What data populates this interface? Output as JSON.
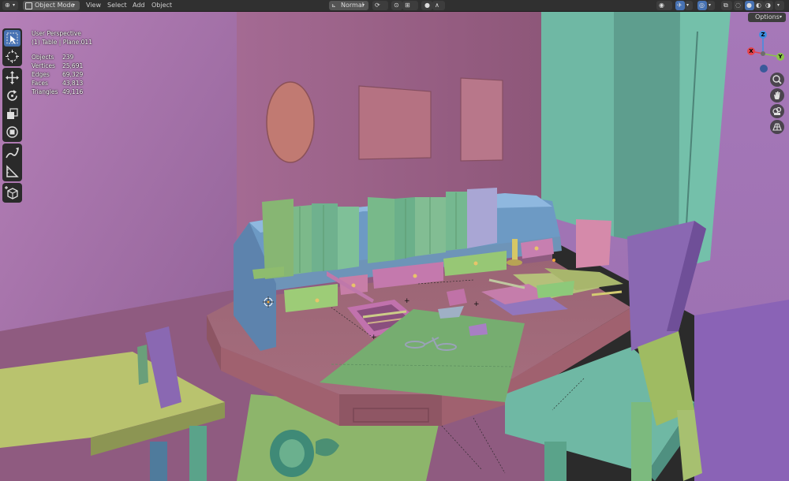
{
  "header": {
    "editor_type_icon": "3d-viewport-icon",
    "mode": "Object Mode",
    "menus": [
      "View",
      "Select",
      "Add",
      "Object"
    ],
    "transform_orientation": "Normal",
    "options_label": "Options"
  },
  "overlay": {
    "view_name": "User Perspective",
    "object_name": "(1) Table | Plane.011",
    "stats": [
      {
        "label": "Objects",
        "value": "239"
      },
      {
        "label": "Vertices",
        "value": "25,691"
      },
      {
        "label": "Edges",
        "value": "69,329"
      },
      {
        "label": "Faces",
        "value": "43,813"
      },
      {
        "label": "Triangles",
        "value": "49,116"
      }
    ]
  },
  "toolbar": {
    "tools": [
      "select-box-icon",
      "cursor-icon",
      "move-icon",
      "rotate-icon",
      "scale-icon",
      "transform-icon",
      "annotate-icon",
      "measure-icon",
      "add-cube-icon"
    ],
    "active": "select-box-icon"
  },
  "gizmo": {
    "axes": [
      "Z",
      "X",
      "Y"
    ],
    "buttons": [
      "zoom-icon",
      "hand-pan-icon",
      "camera-icon",
      "grid-ortho-icon"
    ]
  },
  "colors": {
    "header_bg": "#303030",
    "accent": "#4772b3",
    "wall": "#b07aa3",
    "table": "#a86d7d",
    "book_green": "#79b57f",
    "chair_teal": "#6fb8a4",
    "axis_x": "#e5434d",
    "axis_y": "#8bc34a",
    "axis_z": "#3f8fe3"
  }
}
